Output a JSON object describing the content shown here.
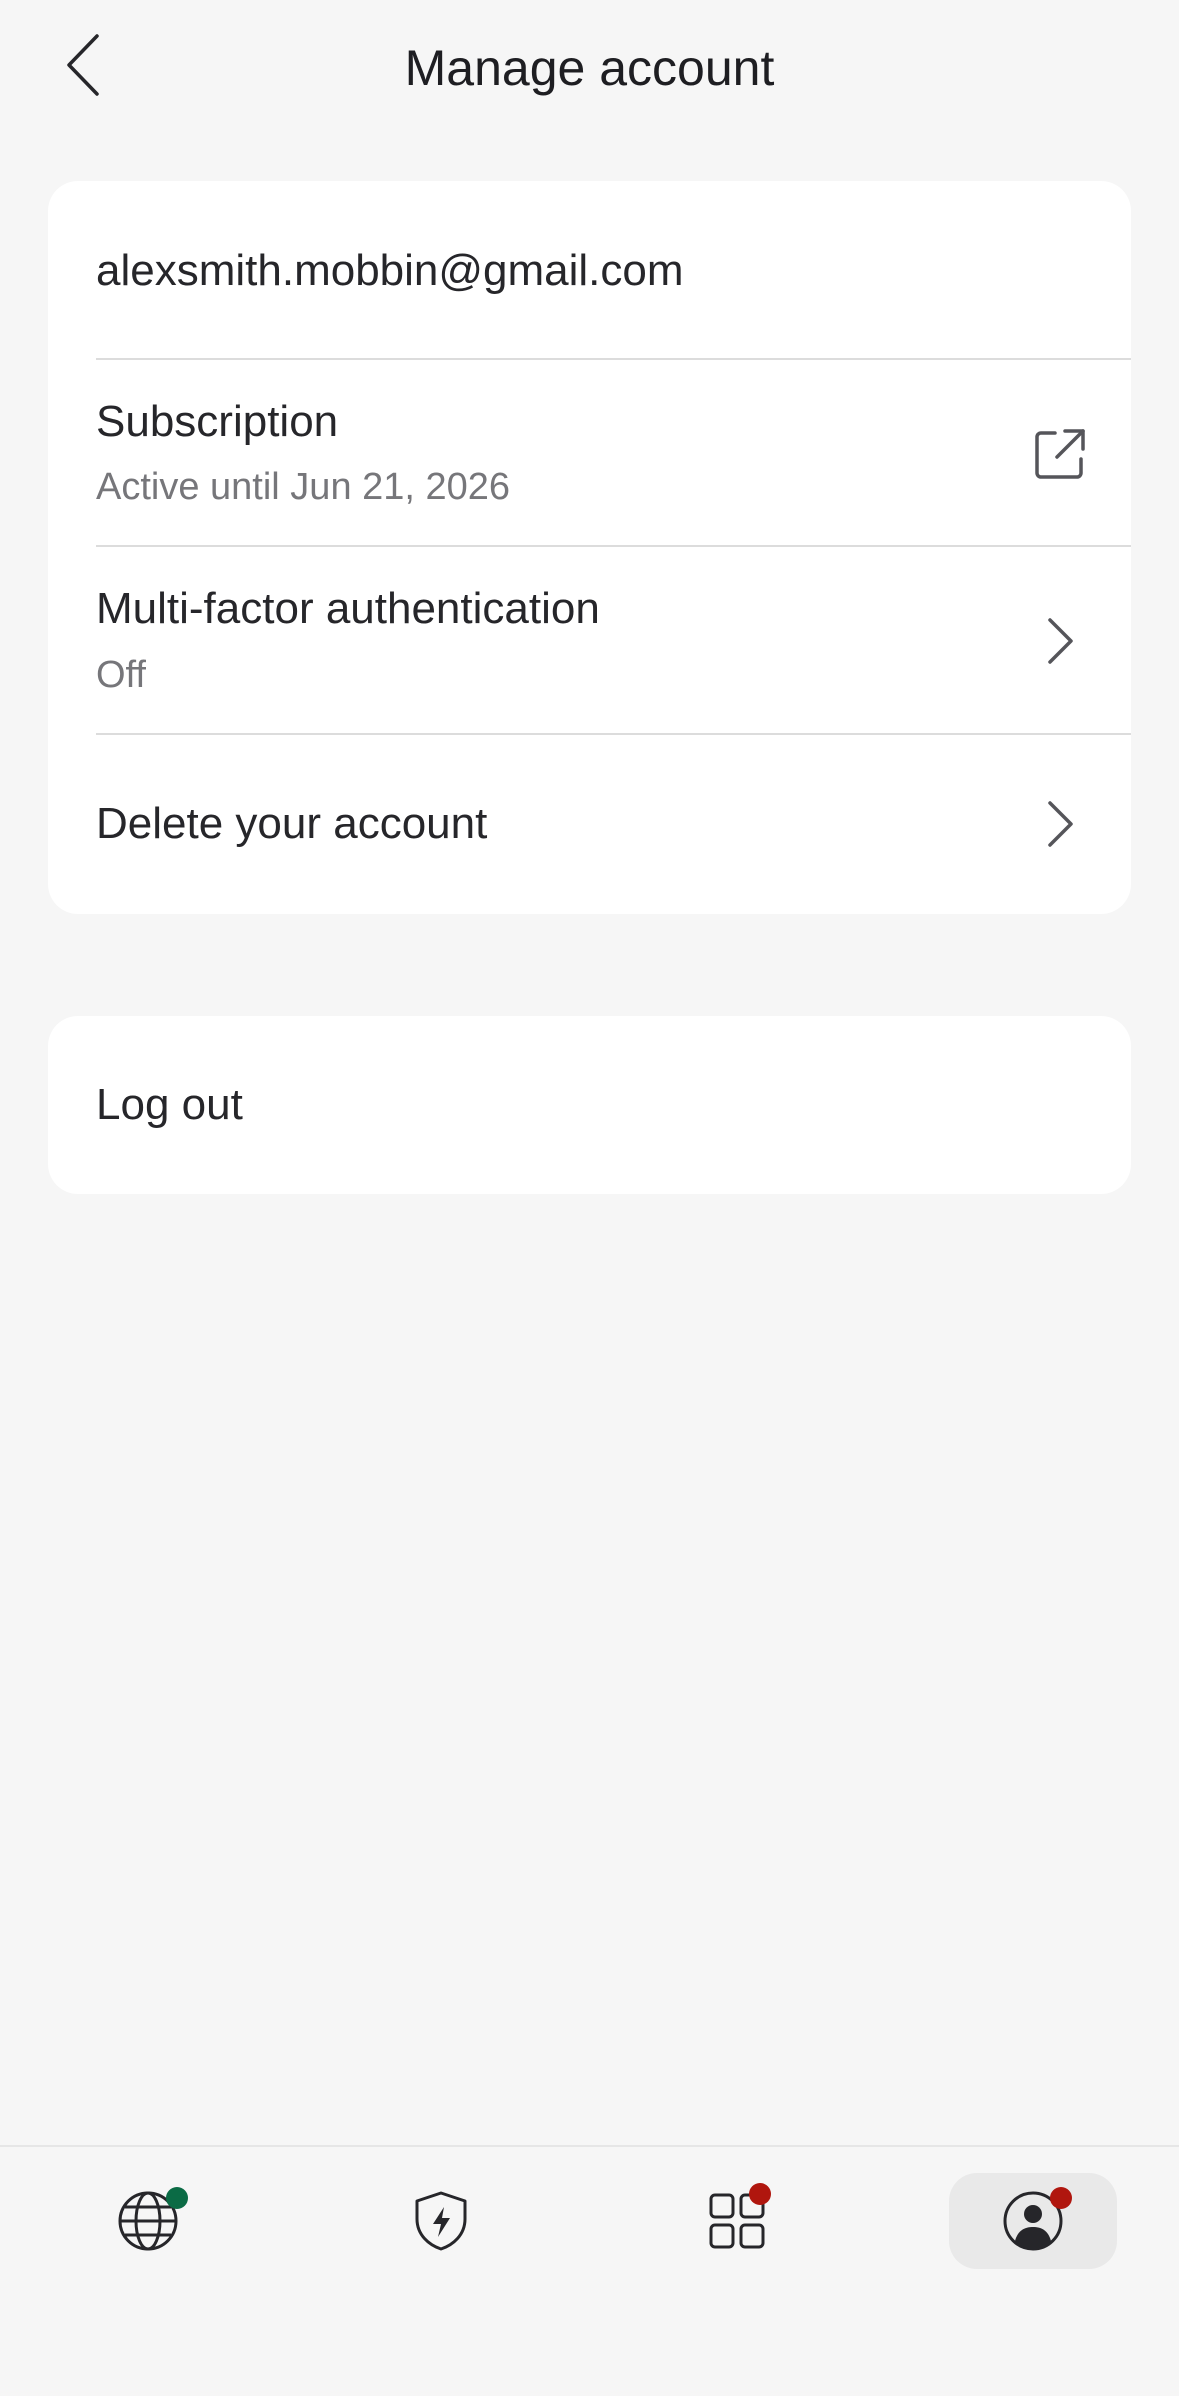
{
  "header": {
    "title": "Manage account",
    "back_icon": "chevron-left-icon"
  },
  "account": {
    "email": "alexsmith.mobbin@gmail.com",
    "subscription": {
      "title": "Subscription",
      "status": "Active until Jun 21, 2026",
      "icon": "external-link-icon"
    },
    "mfa": {
      "title": "Multi-factor authentication",
      "status": "Off",
      "icon": "chevron-right-icon"
    },
    "delete": {
      "title": "Delete your account",
      "icon": "chevron-right-icon"
    }
  },
  "logout": {
    "label": "Log out"
  },
  "bottom_nav": {
    "items": [
      {
        "icon": "globe-icon",
        "badge_color": "#0b6b45",
        "active": false
      },
      {
        "icon": "shield-bolt-icon",
        "badge_color": null,
        "active": false
      },
      {
        "icon": "apps-grid-icon",
        "badge_color": "#b0160e",
        "active": false
      },
      {
        "icon": "account-icon",
        "badge_color": "#b0160e",
        "active": true
      }
    ]
  },
  "colors": {
    "background": "#f6f6f6",
    "card": "#ffffff",
    "text_primary": "#26262a",
    "text_secondary": "#76767a",
    "divider": "#dcdcdc"
  }
}
